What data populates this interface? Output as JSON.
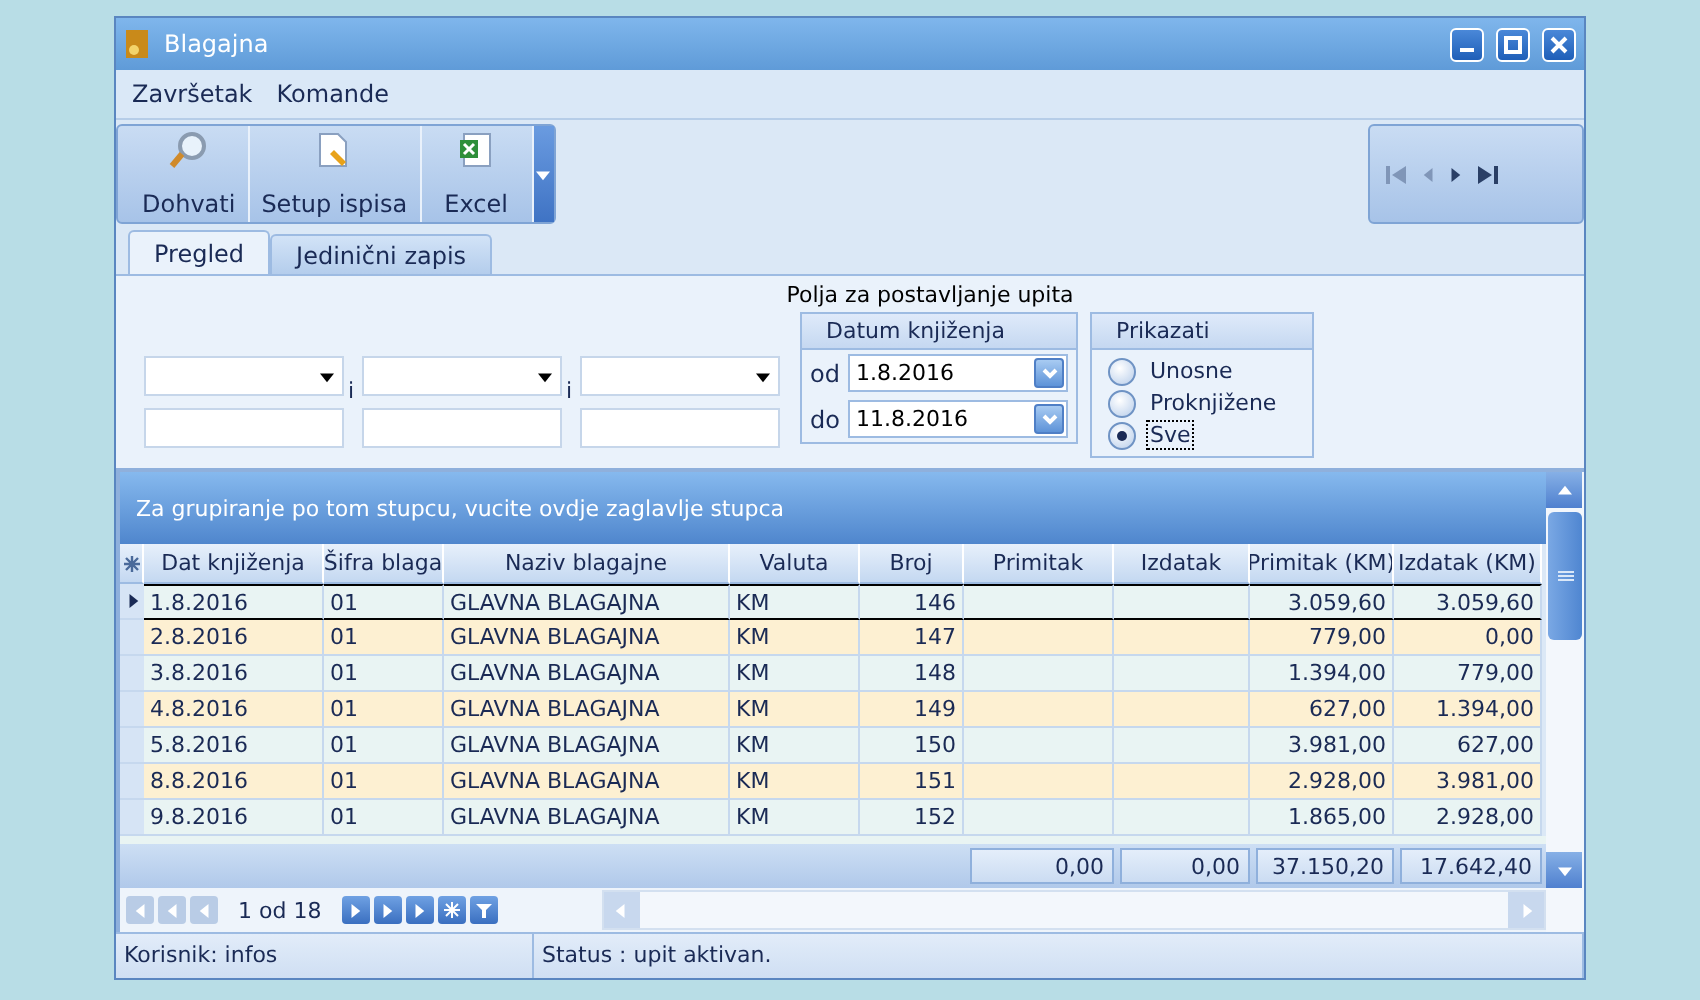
{
  "window": {
    "title": "Blagajna"
  },
  "menu": [
    "Završetak",
    "Komande"
  ],
  "toolbar": [
    {
      "label": "Dohvati",
      "kind": "search"
    },
    {
      "label": "Setup ispisa",
      "kind": "setup"
    },
    {
      "label": "Excel",
      "kind": "excel"
    }
  ],
  "tabs": [
    {
      "label": "Pregled",
      "selected": true
    },
    {
      "label": "Jedinični zapis",
      "selected": false
    }
  ],
  "query": {
    "title": "Polja za postavljanje upita",
    "joiners": [
      "i",
      "i"
    ],
    "date_group": {
      "title": "Datum knjiženja",
      "from_label": "od",
      "from": "1.8.2016",
      "to_label": "do",
      "to": "11.8.2016"
    },
    "show_group": {
      "title": "Prikazati",
      "options": [
        {
          "label": "Unosne",
          "selected": false
        },
        {
          "label": "Proknjižene",
          "selected": false
        },
        {
          "label": "Sve",
          "selected": true
        }
      ]
    }
  },
  "grid": {
    "group_hint": "Za grupiranje po tom stupcu, vucite ovdje zaglavlje stupca",
    "columns": [
      "Dat knjiženja",
      "Šifra blaga",
      "Naziv blagajne",
      "Valuta",
      "Broj",
      "Primitak",
      "Izdatak",
      "Primitak (KM)",
      "Izdatak (KM)"
    ],
    "rows": [
      {
        "selected": true,
        "cells": [
          "1.8.2016",
          "01",
          "GLAVNA BLAGAJNA",
          "KM",
          "146",
          "",
          "",
          "3.059,60",
          "3.059,60"
        ]
      },
      {
        "selected": false,
        "cells": [
          "2.8.2016",
          "01",
          "GLAVNA BLAGAJNA",
          "KM",
          "147",
          "",
          "",
          "779,00",
          "0,00"
        ]
      },
      {
        "selected": false,
        "cells": [
          "3.8.2016",
          "01",
          "GLAVNA BLAGAJNA",
          "KM",
          "148",
          "",
          "",
          "1.394,00",
          "779,00"
        ]
      },
      {
        "selected": false,
        "cells": [
          "4.8.2016",
          "01",
          "GLAVNA BLAGAJNA",
          "KM",
          "149",
          "",
          "",
          "627,00",
          "1.394,00"
        ]
      },
      {
        "selected": false,
        "cells": [
          "5.8.2016",
          "01",
          "GLAVNA BLAGAJNA",
          "KM",
          "150",
          "",
          "",
          "3.981,00",
          "627,00"
        ]
      },
      {
        "selected": false,
        "cells": [
          "8.8.2016",
          "01",
          "GLAVNA BLAGAJNA",
          "KM",
          "151",
          "",
          "",
          "2.928,00",
          "3.981,00"
        ]
      },
      {
        "selected": false,
        "cells": [
          "9.8.2016",
          "01",
          "GLAVNA BLAGAJNA",
          "KM",
          "152",
          "",
          "",
          "1.865,00",
          "2.928,00"
        ]
      }
    ],
    "totals": [
      "0,00",
      "0,00",
      "37.150,20",
      "17.642,40"
    ],
    "pager": "1 od 18"
  },
  "status_bar": [
    "Korisnik: infos",
    "Status : upit aktivan."
  ]
}
